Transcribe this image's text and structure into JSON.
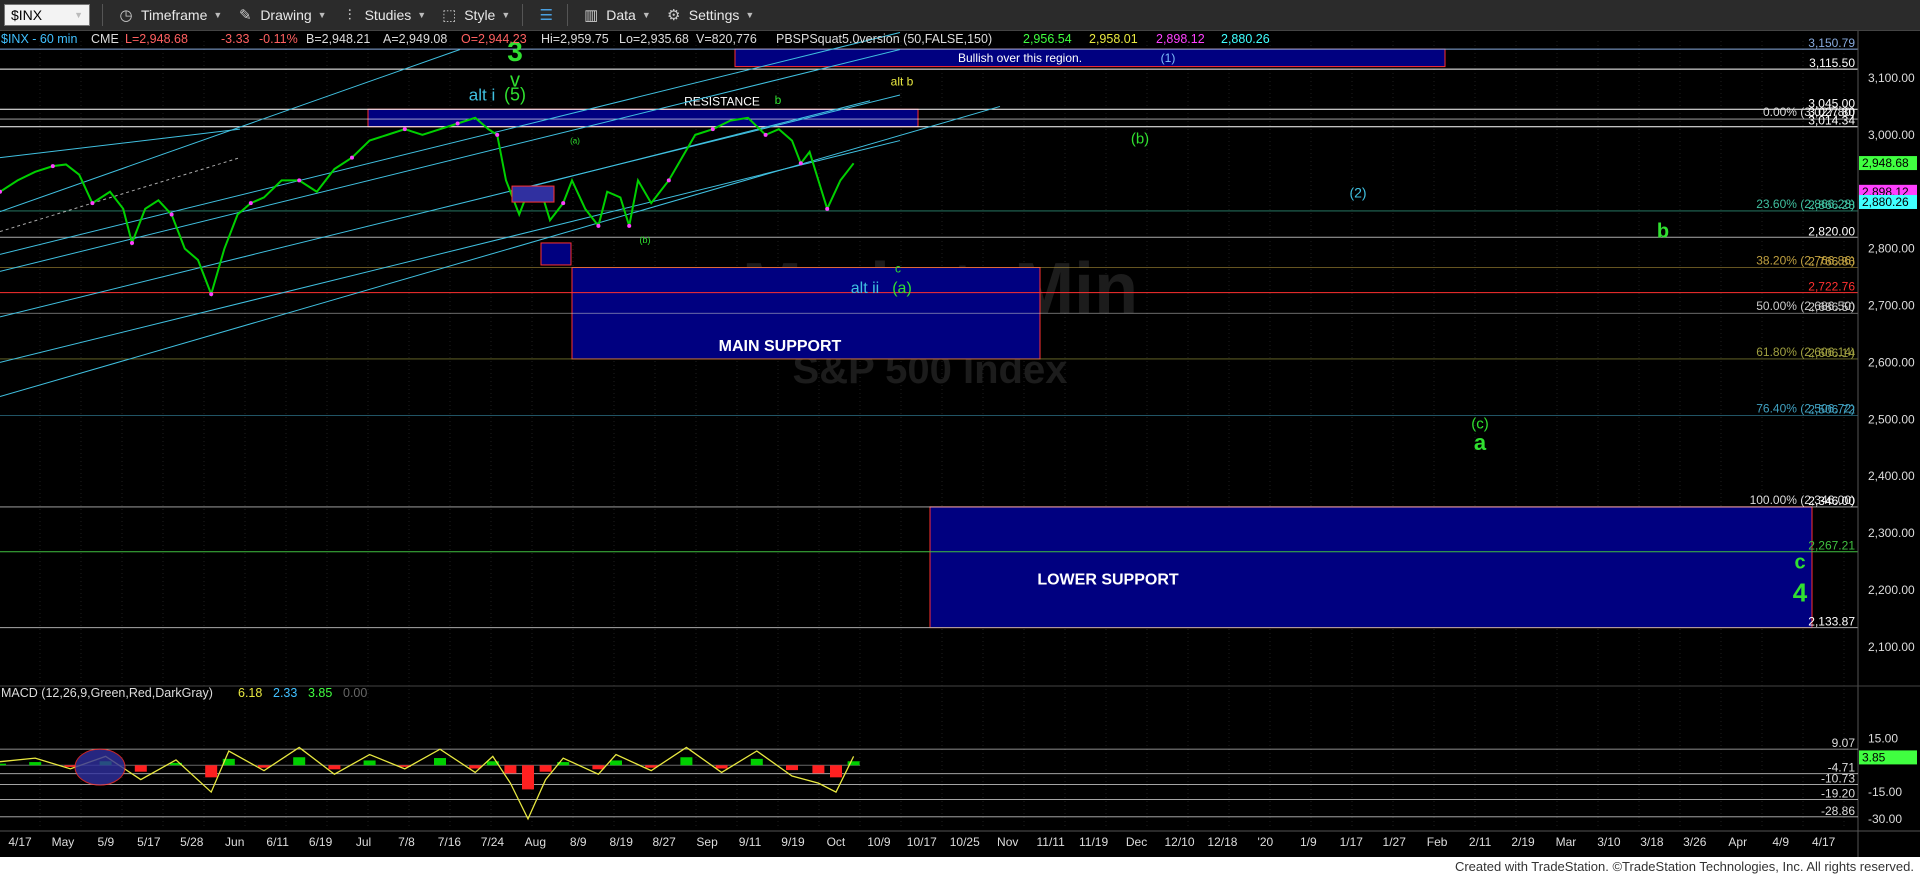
{
  "toolbar": {
    "symbol": "$INX",
    "items": [
      {
        "label": "Timeframe",
        "icon": "clock-icon"
      },
      {
        "label": "Drawing",
        "icon": "pen-icon"
      },
      {
        "label": "Studies",
        "icon": "studies-icon"
      },
      {
        "label": "Style",
        "icon": "style-icon"
      },
      {
        "label": "Data",
        "icon": "data-icon"
      },
      {
        "label": "Settings",
        "icon": "gear-icon"
      }
    ]
  },
  "header": {
    "title": "$INX - 60 min",
    "exchange": "CME",
    "last": "L=2,948.68",
    "change": "-3.33",
    "pct": "-0.11%",
    "bid": "B=2,948.21",
    "ask": "A=2,949.08",
    "open": "O=2,944.23",
    "hi": "Hi=2,959.75",
    "lo": "Lo=2,935.68",
    "vol": "V=820,776",
    "study": "PBSPSquat5.0version (50,FALSE,150)",
    "v1": "2,956.54",
    "v2": "2,958.01",
    "v3": "2,898.12",
    "v4": "2,880.26"
  },
  "colors": {
    "up": "#00d000",
    "down": "#ff2020",
    "box": "#000080",
    "fib": "#ffffff",
    "cyan": "#40c0e0",
    "green_label": "#30e030",
    "yellow_label": "#e8e840"
  },
  "chart_data": {
    "type": "line",
    "price_axis": {
      "ylim": [
        2040,
        3165
      ],
      "ticks": [
        2100,
        2200,
        2300,
        2400,
        2500,
        2600,
        2700,
        2800,
        2900,
        3000,
        3100
      ],
      "tick_labels": [
        "2,100.00",
        "2,200.00",
        "2,300.00",
        "2,400.00",
        "2,500.00",
        "2,600.00",
        "2,700.00",
        "2,800.00",
        "2,900.00",
        "3,000.00",
        "3,100.00"
      ]
    },
    "macd_axis": {
      "ylim": [
        -34,
        22
      ],
      "ticks": [
        15,
        -15,
        -30
      ],
      "tick_labels": [
        "15.00",
        "-15.00",
        "-30.00"
      ]
    },
    "x_tick_labels": [
      "4/17",
      "May",
      "5/9",
      "5/17",
      "5/28",
      "Jun",
      "6/11",
      "6/19",
      "Jul",
      "7/8",
      "7/16",
      "7/24",
      "Aug",
      "8/9",
      "8/19",
      "8/27",
      "Sep",
      "9/11",
      "9/19",
      "Oct",
      "10/9",
      "10/17",
      "10/25",
      "Nov",
      "11/11",
      "11/19",
      "Dec",
      "12/10",
      "12/18",
      "'20",
      "1/9",
      "1/17",
      "1/27",
      "Feb",
      "2/11",
      "2/19",
      "Mar",
      "3/10",
      "3/18",
      "3/26",
      "Apr",
      "4/9",
      "4/17"
    ],
    "price_series": [
      [
        0,
        2900
      ],
      [
        20,
        2920
      ],
      [
        40,
        2935
      ],
      [
        60,
        2945
      ],
      [
        75,
        2948
      ],
      [
        90,
        2930
      ],
      [
        105,
        2880
      ],
      [
        125,
        2900
      ],
      [
        140,
        2870
      ],
      [
        150,
        2810
      ],
      [
        165,
        2870
      ],
      [
        180,
        2885
      ],
      [
        195,
        2860
      ],
      [
        210,
        2800
      ],
      [
        225,
        2780
      ],
      [
        240,
        2720
      ],
      [
        255,
        2800
      ],
      [
        270,
        2860
      ],
      [
        285,
        2880
      ],
      [
        300,
        2890
      ],
      [
        320,
        2920
      ],
      [
        340,
        2920
      ],
      [
        360,
        2900
      ],
      [
        380,
        2940
      ],
      [
        400,
        2960
      ],
      [
        420,
        2990
      ],
      [
        440,
        3000
      ],
      [
        460,
        3010
      ],
      [
        480,
        3000
      ],
      [
        500,
        3010
      ],
      [
        520,
        3020
      ],
      [
        540,
        3030
      ],
      [
        555,
        3010
      ],
      [
        565,
        3000
      ],
      [
        575,
        2920
      ],
      [
        590,
        2860
      ],
      [
        600,
        2900
      ],
      [
        615,
        2900
      ],
      [
        625,
        2850
      ],
      [
        640,
        2880
      ],
      [
        650,
        2920
      ],
      [
        665,
        2870
      ],
      [
        680,
        2840
      ],
      [
        690,
        2900
      ],
      [
        705,
        2890
      ],
      [
        715,
        2840
      ],
      [
        725,
        2920
      ],
      [
        740,
        2880
      ],
      [
        760,
        2920
      ],
      [
        775,
        2960
      ],
      [
        790,
        3000
      ],
      [
        810,
        3010
      ],
      [
        830,
        3025
      ],
      [
        850,
        3030
      ],
      [
        870,
        3000
      ],
      [
        885,
        3010
      ],
      [
        900,
        2990
      ],
      [
        910,
        2950
      ],
      [
        920,
        2970
      ],
      [
        930,
        2920
      ],
      [
        940,
        2870
      ],
      [
        955,
        2920
      ],
      [
        970,
        2950
      ]
    ],
    "macd_series": [
      [
        0,
        2
      ],
      [
        40,
        4
      ],
      [
        80,
        -2
      ],
      [
        120,
        5
      ],
      [
        160,
        -8
      ],
      [
        200,
        3
      ],
      [
        240,
        -15
      ],
      [
        260,
        8
      ],
      [
        300,
        -3
      ],
      [
        340,
        10
      ],
      [
        380,
        -5
      ],
      [
        420,
        6
      ],
      [
        460,
        -2
      ],
      [
        500,
        9
      ],
      [
        540,
        -4
      ],
      [
        560,
        5
      ],
      [
        580,
        -10
      ],
      [
        600,
        -30
      ],
      [
        620,
        -8
      ],
      [
        640,
        4
      ],
      [
        680,
        -5
      ],
      [
        700,
        6
      ],
      [
        740,
        -3
      ],
      [
        780,
        10
      ],
      [
        820,
        -4
      ],
      [
        860,
        8
      ],
      [
        900,
        -6
      ],
      [
        930,
        -10
      ],
      [
        950,
        -15
      ],
      [
        970,
        5
      ]
    ],
    "right_values": [
      "3,150.79",
      "3,115.50",
      "3,045.00",
      "3,027.80",
      "3,014.34",
      "2,948.68",
      "2,898.12",
      "2,880.26",
      "2,866.28",
      "2,820.00",
      "2,766.86",
      "2,722.76",
      "2,686.50",
      "2,606.14",
      "2,506.72",
      "2,346.00",
      "2,267.21",
      "2,133.87"
    ],
    "fibs": [
      {
        "pct": "0.00%",
        "price": 3027.8,
        "label": "0.00% (3,027.80)"
      },
      {
        "pct": "23.60%",
        "price": 2866.28,
        "label": "23.60% (2,866.28)"
      },
      {
        "pct": "38.20%",
        "price": 2766.86,
        "label": "38.20% (2,766.86)"
      },
      {
        "pct": "50.00%",
        "price": 2686.5,
        "label": "50.00% (2,686.50)"
      },
      {
        "pct": "61.80%",
        "price": 2606.14,
        "label": "61.80% (2,606.14)"
      },
      {
        "pct": "76.40%",
        "price": 2506.72,
        "label": "76.40% (2,506.72)"
      },
      {
        "pct": "100.00%",
        "price": 2346.0,
        "label": "100.00% (2,346.00)"
      }
    ],
    "levels": [
      3150.79,
      3115.5,
      3045.0,
      3014.34,
      2820.0,
      2722.76,
      2267.21,
      2133.87
    ],
    "boxes": [
      {
        "label": "Bullish over this region.",
        "extra": "(1)",
        "top": 3150.79,
        "bottom": 3120
      },
      {
        "label": "RESISTANCE",
        "top": 3045,
        "bottom": 3014.34
      },
      {
        "label": "MAIN SUPPORT",
        "top": 2766.86,
        "bottom": 2606.14
      },
      {
        "label": "LOWER SUPPORT",
        "top": 2346,
        "bottom": 2133.87
      }
    ],
    "wave_labels": [
      "3",
      "v",
      "alt i",
      "(5)",
      "b",
      "alt b",
      "(b)",
      "(2)",
      "b",
      "a",
      "(a)",
      "(b)",
      "c",
      "alt ii",
      "(a)",
      "(c)",
      "a",
      "c",
      "4"
    ],
    "macd_legend": {
      "label": "MACD (12,26,9,Green,Red,DarkGray)",
      "v1": "6.18",
      "v2": "2.33",
      "v3": "3.85",
      "v4": "0.00"
    },
    "macd_right_values": [
      "9.07",
      "-4.71",
      "-10.73",
      "-19.20",
      "-28.86"
    ],
    "macd_badge": "3.85",
    "watermark": "S&P 500 Index",
    "watermark_left": "MarketsMin"
  },
  "footer": {
    "text": "Created with TradeStation. ©TradeStation Technologies, Inc. All rights reserved."
  }
}
